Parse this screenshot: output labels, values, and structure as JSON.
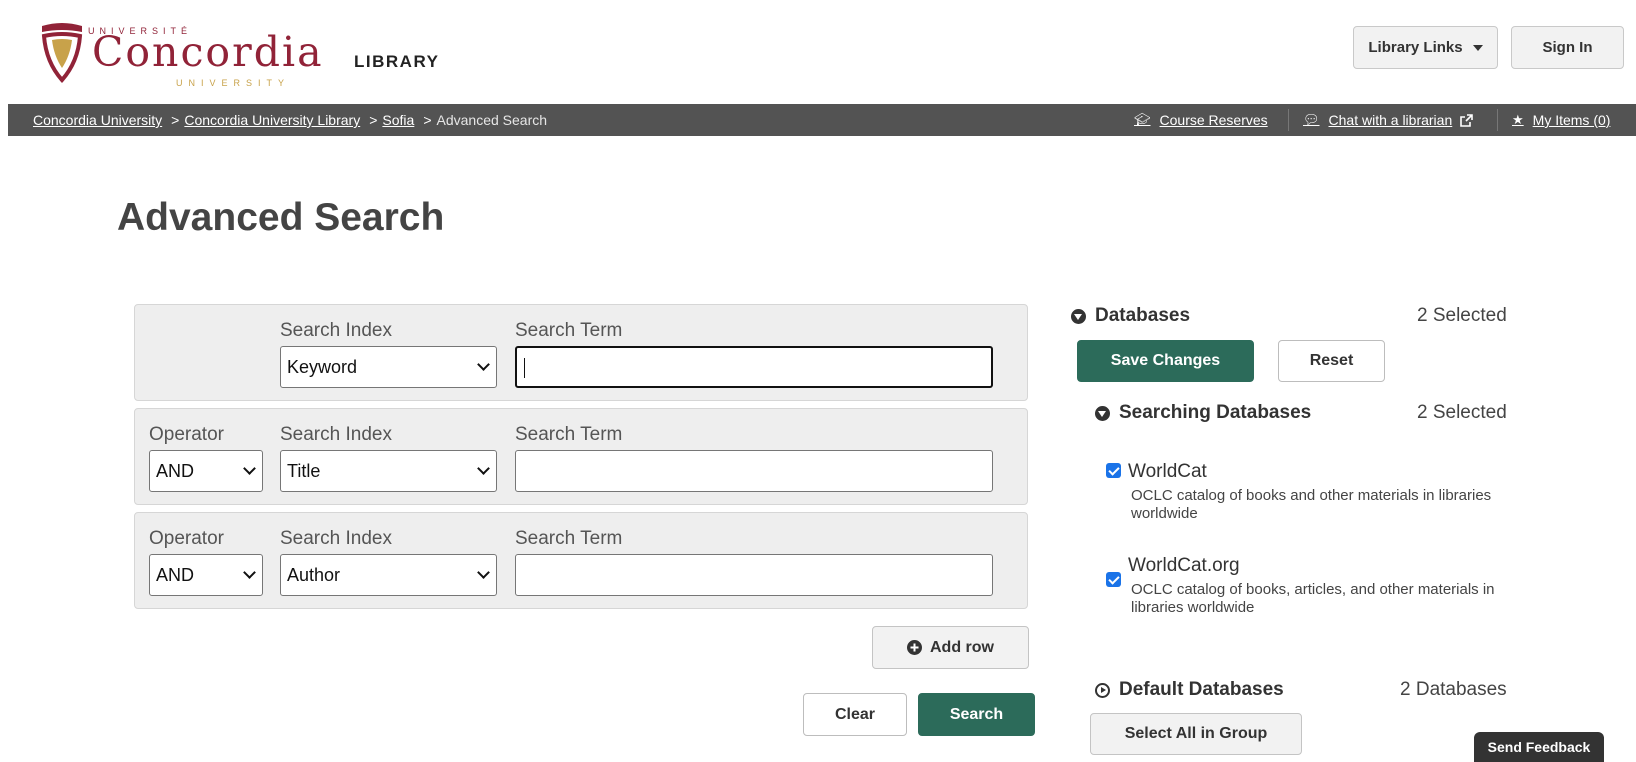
{
  "header": {
    "logo": {
      "top_text": "UNIVERSITÉ",
      "main_text": "Concordia",
      "bottom_text": "UNIVERSITY",
      "library_text": "LIBRARY"
    },
    "library_links_label": "Library Links",
    "sign_in_label": "Sign In"
  },
  "breadcrumb": {
    "items": [
      "Concordia University",
      "Concordia University Library",
      "Sofia"
    ],
    "current": "Advanced Search",
    "separator": ">"
  },
  "utility_links": {
    "course_reserves": "Course Reserves",
    "chat": "Chat with a librarian",
    "my_items": "My Items (0)"
  },
  "page": {
    "title": "Advanced Search"
  },
  "search_form": {
    "labels": {
      "operator": "Operator",
      "index": "Search Index",
      "term": "Search Term"
    },
    "rows": [
      {
        "index": "Keyword",
        "term": ""
      },
      {
        "operator": "AND",
        "index": "Title",
        "term": ""
      },
      {
        "operator": "AND",
        "index": "Author",
        "term": ""
      }
    ],
    "add_row_label": "Add row",
    "clear_label": "Clear",
    "search_label": "Search"
  },
  "databases_panel": {
    "title": "Databases",
    "selected_count": "2 Selected",
    "save_label": "Save Changes",
    "reset_label": "Reset",
    "searching": {
      "title": "Searching Databases",
      "count": "2 Selected",
      "items": [
        {
          "name": "WorldCat",
          "description": "OCLC catalog of books and other materials in libraries worldwide",
          "checked": true
        },
        {
          "name": "WorldCat.org",
          "description": "OCLC catalog of books, articles, and other materials in libraries worldwide",
          "checked": true
        }
      ]
    },
    "default": {
      "title": "Default Databases",
      "count": "2 Databases",
      "select_all_label": "Select All in Group"
    }
  },
  "feedback_label": "Send Feedback",
  "colors": {
    "accent_green": "#2c6b5a",
    "brand_maroon": "#912338",
    "brand_gold": "#c8a24a",
    "bar_grey": "#535353"
  }
}
